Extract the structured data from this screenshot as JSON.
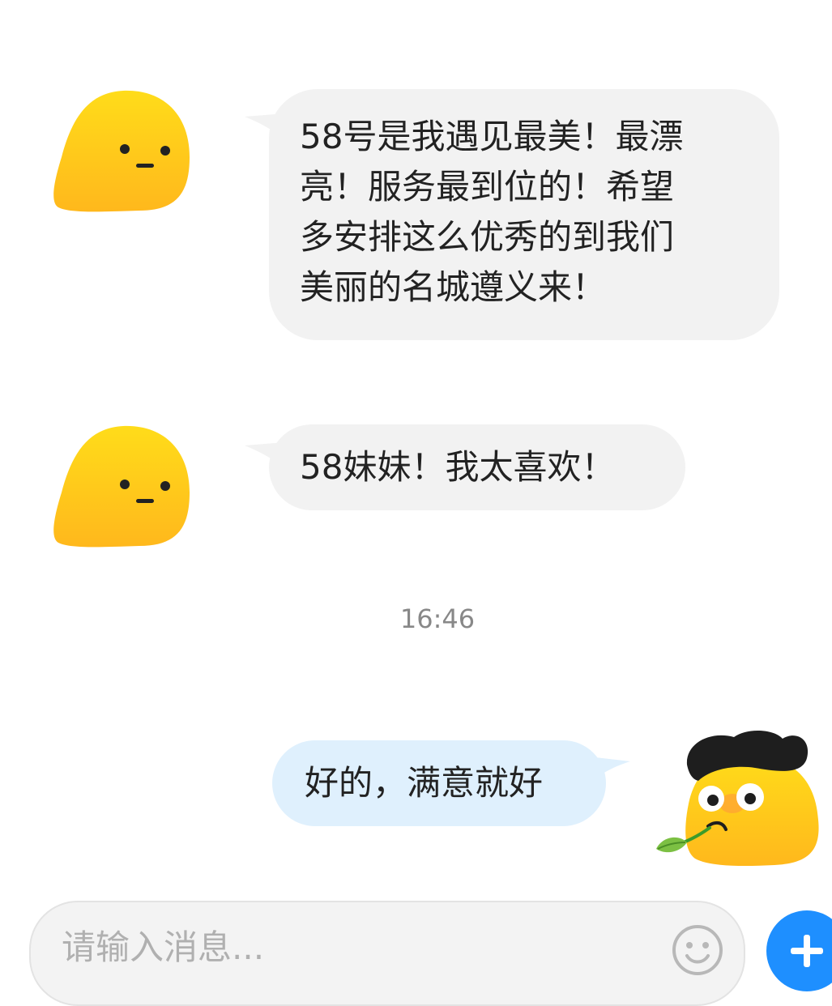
{
  "messages": [
    {
      "sender": "other",
      "lines": [
        "58号是我遇见最美！最漂",
        "亮！服务最到位的！希望",
        "多安排这么优秀的到我们",
        "美丽的名城遵义来！"
      ]
    },
    {
      "sender": "other",
      "lines": [
        "58妹妹！我太喜欢！"
      ]
    },
    {
      "sender": "self",
      "lines": [
        "好的，满意就好"
      ]
    }
  ],
  "timestamp": "16:46",
  "input": {
    "placeholder": "请输入消息..."
  },
  "colors": {
    "incoming_bubble": "#f2f2f2",
    "outgoing_bubble": "#dff0fd",
    "avatar_yellow": "#ffd21a",
    "add_button": "#1e8fff"
  },
  "icons": [
    "blob-avatar-icon",
    "user-avatar-icon",
    "emoji-icon",
    "plus-icon"
  ]
}
